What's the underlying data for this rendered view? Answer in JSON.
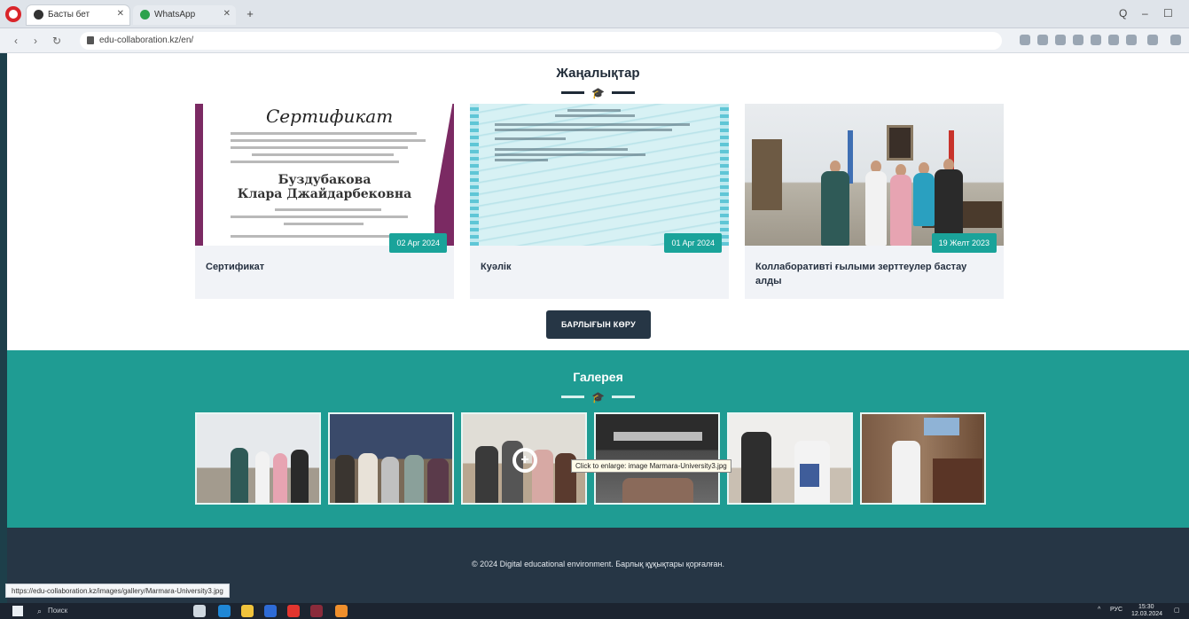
{
  "browser": {
    "tabs": [
      {
        "label": "Басты бет",
        "active": true
      },
      {
        "label": "WhatsApp",
        "active": false
      }
    ],
    "new_tab": "+",
    "url": "edu-collaboration.kz/en/",
    "window_controls": [
      "Q",
      "–",
      "☐"
    ]
  },
  "news": {
    "title": "Жаңалықтар",
    "cards": [
      {
        "title": "Сертификат",
        "date": "02 Apr 2024",
        "image_text": [
          "Сертификат",
          "Буздубакова",
          "Клара Джайдарбековна"
        ]
      },
      {
        "title": "Куәлік",
        "date": "01 Apr 2024",
        "image_text": []
      },
      {
        "title": "Коллаборативті ғылыми зерттеулер бастау алды",
        "date": "19 Желт 2023",
        "image_text": []
      }
    ],
    "see_all": "БАРЛЫҒЫН КӨРУ"
  },
  "gallery": {
    "title": "Галерея",
    "tooltip": "Click to enlarge: image Marmara-University3.jpg",
    "thumb_count": 6
  },
  "footer": {
    "text": "© 2024 Digital educational environment. Барлық құқықтары қорғалған."
  },
  "status_bar": {
    "url": "https://edu-collaboration.kz/images/gallery/Marmara-University3.jpg"
  },
  "taskbar": {
    "search_placeholder": "Поиск",
    "lang": "РУС",
    "time": "15:30",
    "date": "12.03.2024"
  },
  "colors": {
    "teal": "#1f9c93",
    "dark_navy": "#263645",
    "date_badge": "#1aa39a"
  }
}
